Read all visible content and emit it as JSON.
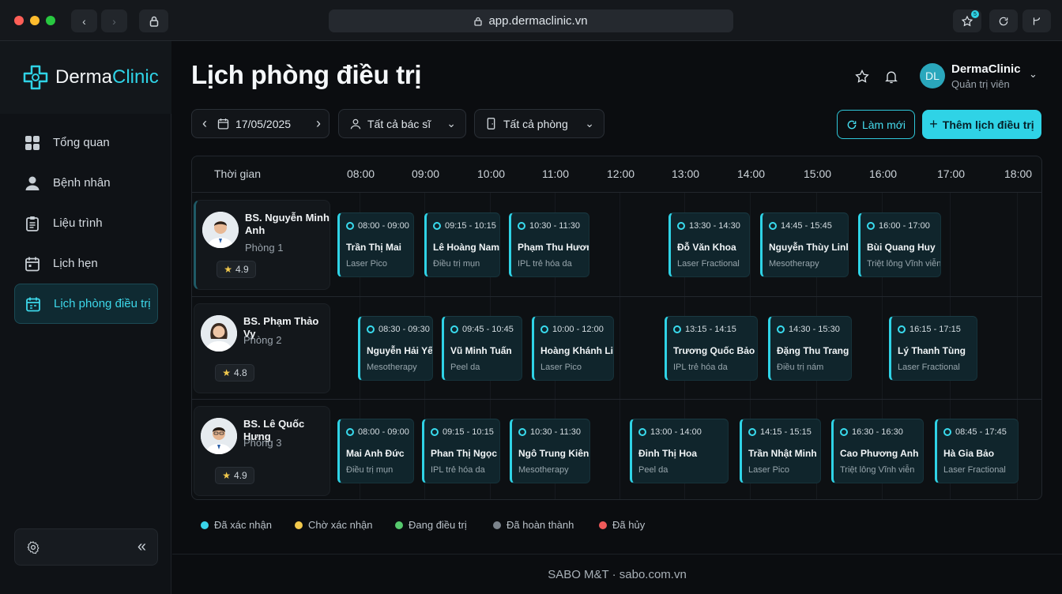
{
  "browser": {
    "url": "app.dermaclinic.vn",
    "badge_count": "5"
  },
  "brand": {
    "name_part1": "Derma",
    "name_part2": "Clinic",
    "accent": "#2fd3e6"
  },
  "sidebar": {
    "items": [
      {
        "label": "Tổng quan",
        "icon": "grid-icon"
      },
      {
        "label": "Bệnh nhân",
        "icon": "user-icon"
      },
      {
        "label": "Liệu trình",
        "icon": "clipboard-icon"
      },
      {
        "label": "Lịch hẹn",
        "icon": "calendar-icon"
      },
      {
        "label": "Lịch phòng điều trị",
        "icon": "calendar-clock-icon",
        "active": true
      }
    ]
  },
  "header": {
    "title": "Lịch phòng điều trị",
    "user_initials": "DL",
    "user_name": "DermaClinic",
    "user_role": "Quản trị viên"
  },
  "filters": {
    "date": "17/05/2025",
    "doctor": "Tất cả bác sĩ",
    "room": "Tất cả phòng"
  },
  "actions": {
    "refresh": "Làm mới",
    "add": "Thêm lịch điều trị"
  },
  "schedule": {
    "time_header": "Thời gian",
    "hours": [
      "08:00",
      "09:00",
      "10:00",
      "11:00",
      "12:00",
      "13:00",
      "14:00",
      "15:00",
      "16:00",
      "17:00",
      "18:00"
    ],
    "rows": [
      {
        "doctor": "BS. Nguyễn Minh Anh",
        "room": "Phòng 1",
        "rating": "4.9",
        "appointments": [
          {
            "time": "08:00 - 09:00",
            "patient": "Trần Thị Mai",
            "service": "Laser Pico"
          },
          {
            "time": "09:15 - 10:15",
            "patient": "Lê Hoàng Nam",
            "service": "Điều trị mụn"
          },
          {
            "time": "10:30 - 11:30",
            "patient": "Phạm Thu Hương",
            "service": "IPL trẻ hóa da"
          },
          {
            "time": "13:30 - 14:30",
            "patient": "Đỗ Văn Khoa",
            "service": "Laser Fractional"
          },
          {
            "time": "14:45 - 15:45",
            "patient": "Nguyễn Thùy Linh",
            "service": "Mesotherapy"
          },
          {
            "time": "16:00 - 17:00",
            "patient": "Bùi Quang Huy",
            "service": "Triệt lông Vĩnh viễn"
          }
        ]
      },
      {
        "doctor": "BS. Phạm Thảo Vy",
        "room": "Phòng 2",
        "rating": "4.8",
        "appointments": [
          {
            "time": "08:30 - 09:30",
            "patient": "Nguyễn Hải Yến",
            "service": "Mesotherapy"
          },
          {
            "time": "09:45 - 10:45",
            "patient": "Vũ Minh Tuấn",
            "service": "Peel da"
          },
          {
            "time": "10:00 - 12:00",
            "patient": "Hoàng Khánh Linh",
            "service": "Laser Pico"
          },
          {
            "time": "13:15 - 14:15",
            "patient": "Trương Quốc Bảo",
            "service": "IPL trẻ hóa da"
          },
          {
            "time": "14:30 - 15:30",
            "patient": "Đặng Thu Trang",
            "service": "Điều trị nám"
          },
          {
            "time": "16:15 - 17:15",
            "patient": "Lý Thanh Tùng",
            "service": "Laser Fractional"
          }
        ]
      },
      {
        "doctor": "BS. Lê Quốc Hưng",
        "room": "Phòng 3",
        "rating": "4.9",
        "appointments": [
          {
            "time": "08:00 - 09:00",
            "patient": "Mai Anh Đức",
            "service": "Điều trị mụn"
          },
          {
            "time": "09:15 - 10:15",
            "patient": "Phan Thị Ngọc",
            "service": "IPL trẻ hóa da"
          },
          {
            "time": "10:30 - 11:30",
            "patient": "Ngô Trung Kiên",
            "service": "Mesotherapy"
          },
          {
            "time": "13:00 - 14:00",
            "patient": "Đinh Thị Hoa",
            "service": "Peel da"
          },
          {
            "time": "14:15 - 15:15",
            "patient": "Trần Nhật Minh",
            "service": "Laser Pico"
          },
          {
            "time": "16:30 - 16:30",
            "patient": "Cao Phương Anh",
            "service": "Triệt lông Vĩnh viễn"
          },
          {
            "time": "08:45 - 17:45",
            "patient": "Hà Gia Bảo",
            "service": "Laser Fractional"
          }
        ]
      }
    ]
  },
  "legend": [
    {
      "label": "Đã xác nhận",
      "color": "#39d4ea"
    },
    {
      "label": "Chờ xác nhận",
      "color": "#f2c94c"
    },
    {
      "label": "Đang điều trị",
      "color": "#56c96d"
    },
    {
      "label": "Đã hoàn thành",
      "color": "#7c848c"
    },
    {
      "label": "Đã hủy",
      "color": "#ef5a5a"
    }
  ],
  "footer": "SABO M&T · sabo.com.vn"
}
